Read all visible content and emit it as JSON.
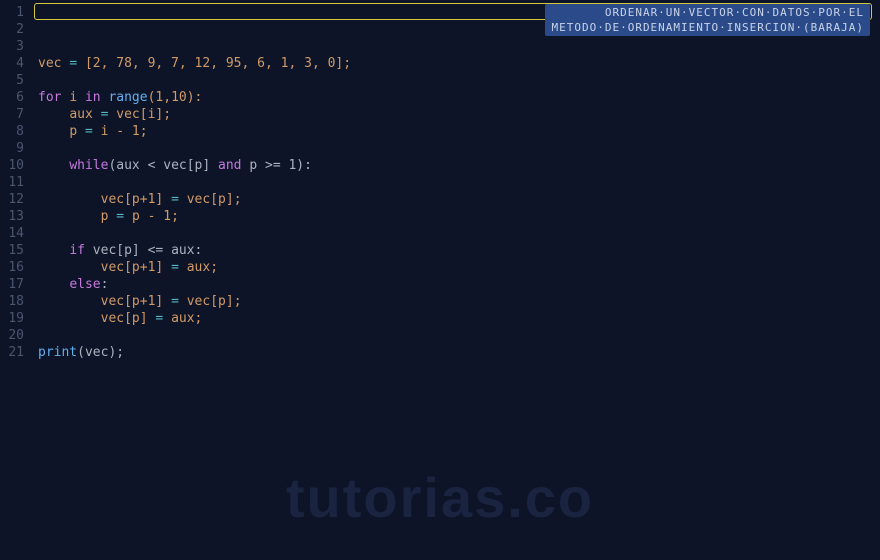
{
  "banner": {
    "line1": "ORDENAR·UN·VECTOR·CON·DATOS·POR·EL",
    "line2": "METODO·DE·ORDENAMIENTO·INSERCION·(BARAJA)"
  },
  "watermark": "tutorias.co",
  "lineNumbers": [
    "1",
    "2",
    "3",
    "4",
    "5",
    "6",
    "7",
    "8",
    "9",
    "10",
    "11",
    "12",
    "13",
    "14",
    "15",
    "16",
    "17",
    "18",
    "19",
    "20",
    "21"
  ],
  "code": {
    "l4": {
      "vec": "vec",
      "eq": "=",
      "vals": "[2, 78, 9, 7, 12, 95, 6, 1, 3, 0];"
    },
    "l6": {
      "for": "for",
      "i": "i",
      "in": "in",
      "range": "range",
      "args": "(1,10):"
    },
    "l7": {
      "aux": "aux",
      "eq": "=",
      "rhs": "vec[i];"
    },
    "l8": {
      "p": "p",
      "eq": "=",
      "rhs": "i - 1;"
    },
    "l10": {
      "while": "while",
      "cond": "(aux < vec[p] ",
      "and": "and",
      "cond2": " p >= 1):"
    },
    "l12": {
      "lhs": "vec[p+1]",
      "eq": "=",
      "rhs": "vec[p];"
    },
    "l13": {
      "lhs": "p",
      "eq": "=",
      "rhs": "p - 1;"
    },
    "l15": {
      "if": "if",
      "cond": "vec[p] <= aux:"
    },
    "l16": {
      "lhs": "vec[p+1]",
      "eq": "=",
      "rhs": "aux;"
    },
    "l17": {
      "else": "else",
      ":": ":"
    },
    "l18": {
      "lhs": "vec[p+1]",
      "eq": "=",
      "rhs": "vec[p];"
    },
    "l19": {
      "lhs": "vec[p]",
      "eq": "=",
      "rhs": "aux;"
    },
    "l21": {
      "print": "print",
      "arg": "(vec);"
    }
  }
}
